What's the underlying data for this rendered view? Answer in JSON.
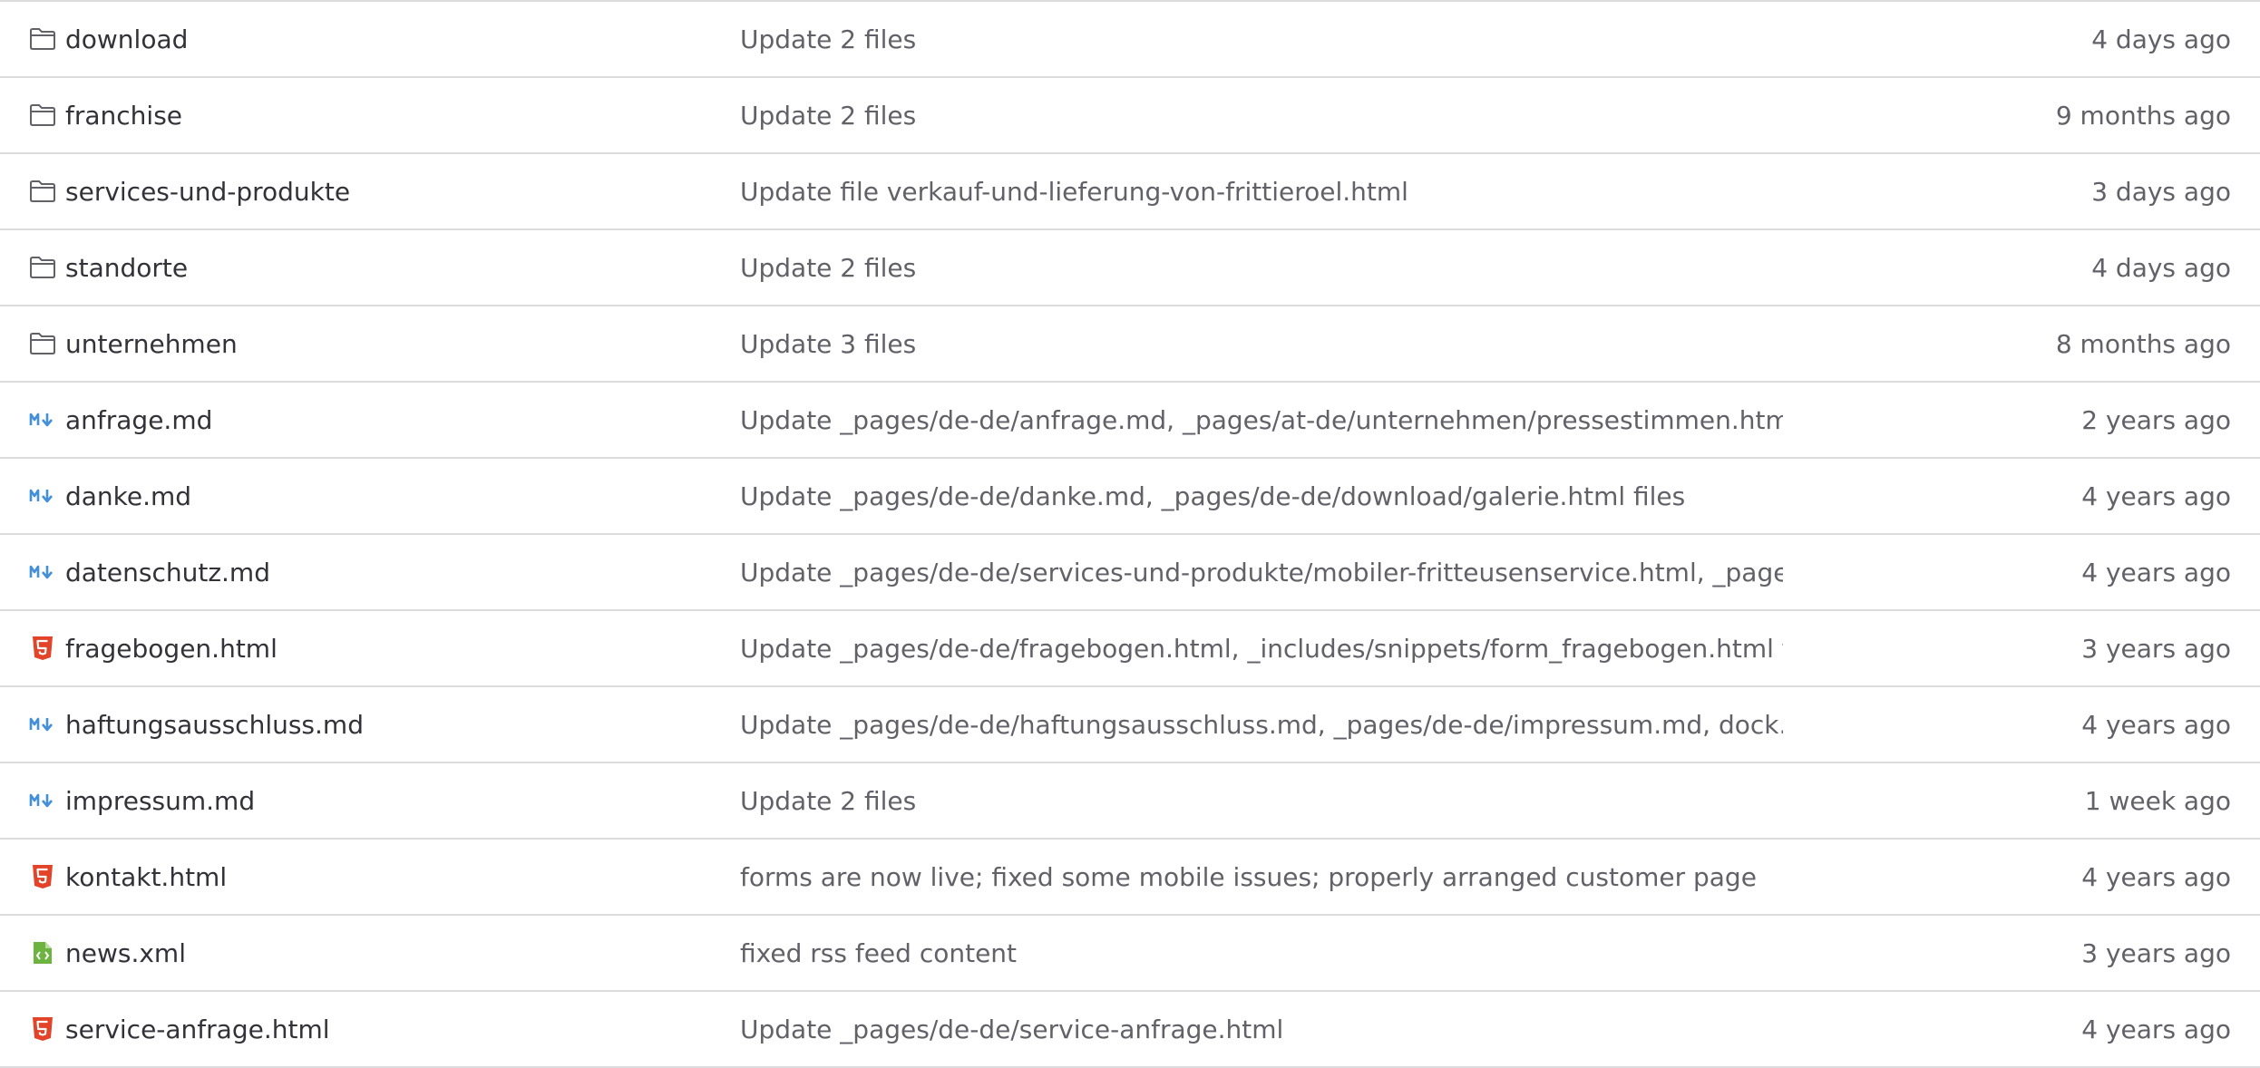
{
  "colors": {
    "border": "#dcdcde",
    "name_text": "#333238",
    "muted_text": "#626168",
    "folder_icon": "#626168",
    "markdown_icon": "#428fdc",
    "html_icon": "#e24329",
    "xml_icon": "#6db33f"
  },
  "files": {
    "rows": [
      {
        "name": "download",
        "icon": "folder-icon",
        "commit": "Update 2 files",
        "date": "4 days ago"
      },
      {
        "name": "franchise",
        "icon": "folder-icon",
        "commit": "Update 2 files",
        "date": "9 months ago"
      },
      {
        "name": "services-und-produkte",
        "icon": "folder-icon",
        "commit": "Update file verkauf-und-lieferung-von-frittieroel.html",
        "date": "3 days ago"
      },
      {
        "name": "standorte",
        "icon": "folder-icon",
        "commit": "Update 2 files",
        "date": "4 days ago"
      },
      {
        "name": "unternehmen",
        "icon": "folder-icon",
        "commit": "Update 3 files",
        "date": "8 months ago"
      },
      {
        "name": "anfrage.md",
        "icon": "markdown-icon",
        "commit": "Update _pages/de-de/anfrage.md, _pages/at-de/unternehmen/pressestimmen.html...",
        "date": "2 years ago"
      },
      {
        "name": "danke.md",
        "icon": "markdown-icon",
        "commit": "Update _pages/de-de/danke.md, _pages/de-de/download/galerie.html files",
        "date": "4 years ago"
      },
      {
        "name": "datenschutz.md",
        "icon": "markdown-icon",
        "commit": "Update _pages/de-de/services-und-produkte/mobiler-fritteusenservice.html, _page...",
        "date": "4 years ago"
      },
      {
        "name": "fragebogen.html",
        "icon": "html5-icon",
        "commit": "Update _pages/de-de/fragebogen.html, _includes/snippets/form_fragebogen.html f...",
        "date": "3 years ago"
      },
      {
        "name": "haftungsausschluss.md",
        "icon": "markdown-icon",
        "commit": "Update _pages/de-de/haftungsausschluss.md, _pages/de-de/impressum.md, dock...",
        "date": "4 years ago"
      },
      {
        "name": "impressum.md",
        "icon": "markdown-icon",
        "commit": "Update 2 files",
        "date": "1 week ago"
      },
      {
        "name": "kontakt.html",
        "icon": "html5-icon",
        "commit": "forms are now live; fixed some mobile issues; properly arranged customer page",
        "date": "4 years ago"
      },
      {
        "name": "news.xml",
        "icon": "code-file-icon",
        "commit": "fixed rss feed content",
        "date": "3 years ago"
      },
      {
        "name": "service-anfrage.html",
        "icon": "html5-icon",
        "commit": "Update _pages/de-de/service-anfrage.html",
        "date": "4 years ago"
      }
    ]
  }
}
